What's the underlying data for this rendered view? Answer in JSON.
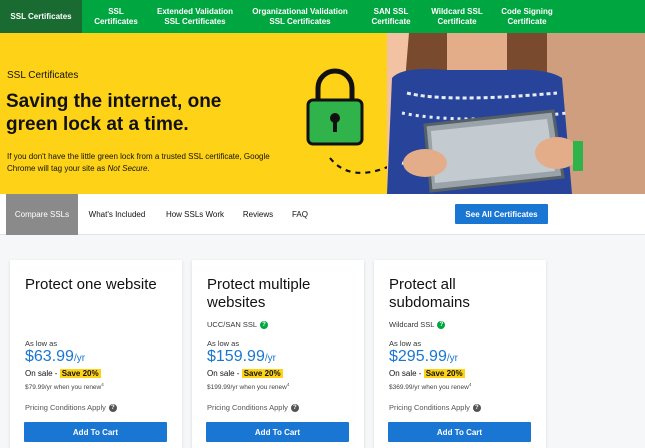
{
  "nav": {
    "home": "SSL Certificates",
    "items": [
      {
        "label": "SSL\nCertificates"
      },
      {
        "label": "Extended Validation\nSSL Certificates"
      },
      {
        "label": "Organizational Validation\nSSL Certificates"
      },
      {
        "label": "SAN SSL\nCertificate"
      },
      {
        "label": "Wildcard SSL\nCertificate"
      },
      {
        "label": "Code Signing\nCertificate"
      }
    ]
  },
  "hero": {
    "kicker": "SSL Certificates",
    "headline": "Saving the internet, one green lock at a time.",
    "desc_before": "If you don't have the little green lock from a trusted SSL certificate, Google Chrome will tag your site as ",
    "desc_em": "Not Secure",
    "desc_after": "."
  },
  "subnav": {
    "tabs": [
      "Compare SSLs",
      "What's Included",
      "How SSLs Work",
      "Reviews",
      "FAQ"
    ],
    "cta": "See All Certificates"
  },
  "cards": [
    {
      "title": "Protect one website",
      "subtitle": "",
      "as_low_as": "As low as",
      "price": "$63.99",
      "unit": "/yr",
      "on_sale": "On sale - ",
      "save": "Save 20%",
      "renew": "$79.99/yr when you renew",
      "renew_note": "4",
      "conditions": "Pricing Conditions Apply",
      "button": "Add To Cart"
    },
    {
      "title": "Protect multiple websites",
      "subtitle": "UCC/SAN SSL",
      "as_low_as": "As low as",
      "price": "$159.99",
      "unit": "/yr",
      "on_sale": "On sale - ",
      "save": "Save 20%",
      "renew": "$199.99/yr when you renew",
      "renew_note": "4",
      "conditions": "Pricing Conditions Apply",
      "button": "Add To Cart"
    },
    {
      "title": "Protect all subdomains",
      "subtitle": "Wildcard SSL",
      "as_low_as": "As low as",
      "price": "$295.99",
      "unit": "/yr",
      "on_sale": "On sale - ",
      "save": "Save 20%",
      "renew": "$369.99/yr when you renew",
      "renew_note": "4",
      "conditions": "Pricing Conditions Apply",
      "button": "Add To Cart"
    }
  ],
  "help_glyph": "?",
  "colors": {
    "brand_green": "#00a63f",
    "dark_green": "#1a6b31",
    "hero_yellow": "#fed317",
    "link_blue": "#1976d2"
  }
}
